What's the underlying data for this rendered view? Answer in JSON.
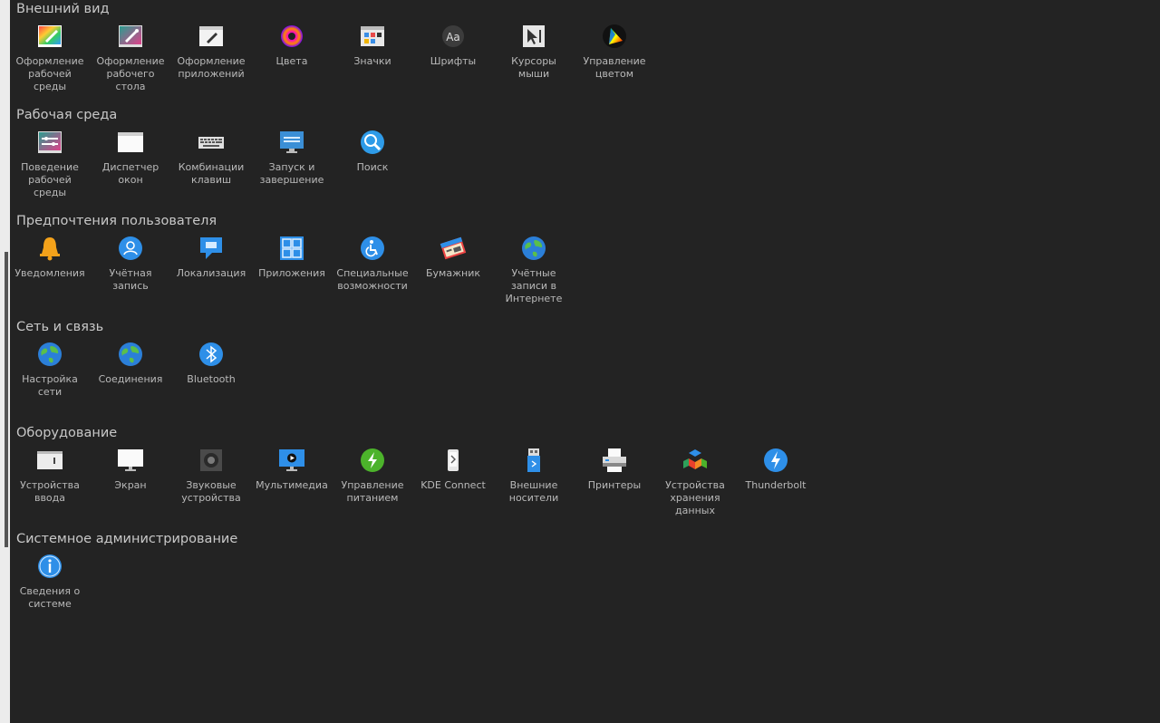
{
  "sections": [
    {
      "title": "Внешний вид",
      "items": [
        {
          "label": "Оформление\nрабочей\nсреды",
          "icon": "workspace-theme-icon"
        },
        {
          "label": "Оформление\nрабочего\nстола",
          "icon": "desktop-theme-icon"
        },
        {
          "label": "Оформление\nприложений",
          "icon": "application-style-icon"
        },
        {
          "label": "Цвета",
          "icon": "colors-icon"
        },
        {
          "label": "Значки",
          "icon": "icons-icon"
        },
        {
          "label": "Шрифты",
          "icon": "fonts-icon"
        },
        {
          "label": "Курсоры\nмыши",
          "icon": "cursors-icon"
        },
        {
          "label": "Управление\nцветом",
          "icon": "color-management-icon"
        }
      ]
    },
    {
      "title": "Рабочая среда",
      "items": [
        {
          "label": "Поведение\nрабочей\nсреды",
          "icon": "workspace-behavior-icon"
        },
        {
          "label": "Диспетчер\nокон",
          "icon": "window-manager-icon"
        },
        {
          "label": "Комбинации\nклавиш",
          "icon": "keyboard-shortcuts-icon"
        },
        {
          "label": "Запуск и\nзавершение",
          "icon": "startup-shutdown-icon"
        },
        {
          "label": "Поиск",
          "icon": "search-icon"
        }
      ]
    },
    {
      "title": "Предпочтения пользователя",
      "items": [
        {
          "label": "Уведомления",
          "icon": "notifications-bell-icon"
        },
        {
          "label": "Учётная\nзапись",
          "icon": "user-account-icon"
        },
        {
          "label": "Локализация",
          "icon": "localization-icon"
        },
        {
          "label": "Приложения",
          "icon": "applications-icon"
        },
        {
          "label": "Специальные\nвозможности",
          "icon": "accessibility-icon"
        },
        {
          "label": "Бумажник",
          "icon": "wallet-icon"
        },
        {
          "label": "Учётные\nзаписи в\nИнтернете",
          "icon": "online-accounts-icon"
        }
      ]
    },
    {
      "title": "Сеть и связь",
      "items": [
        {
          "label": "Настройка\nсети",
          "icon": "network-settings-icon"
        },
        {
          "label": "Соединения",
          "icon": "connections-icon"
        },
        {
          "label": "Bluetooth",
          "icon": "bluetooth-icon"
        }
      ]
    },
    {
      "title": "Оборудование",
      "items": [
        {
          "label": "Устройства\nввода",
          "icon": "input-devices-icon"
        },
        {
          "label": "Экран",
          "icon": "display-icon"
        },
        {
          "label": "Звуковые\nустройства",
          "icon": "audio-devices-icon"
        },
        {
          "label": "Мультимедиа",
          "icon": "multimedia-icon"
        },
        {
          "label": "Управление\nпитанием",
          "icon": "power-management-icon"
        },
        {
          "label": "KDE Connect",
          "icon": "kde-connect-icon"
        },
        {
          "label": "Внешние\nносители",
          "icon": "removable-storage-icon"
        },
        {
          "label": "Принтеры",
          "icon": "printers-icon"
        },
        {
          "label": "Устройства\nхранения\nданных",
          "icon": "storage-devices-icon"
        },
        {
          "label": "Thunderbolt",
          "icon": "thunderbolt-icon"
        }
      ]
    },
    {
      "title": "Системное администрирование",
      "items": [
        {
          "label": "Сведения о\nсистеме",
          "icon": "system-info-icon"
        }
      ]
    }
  ]
}
